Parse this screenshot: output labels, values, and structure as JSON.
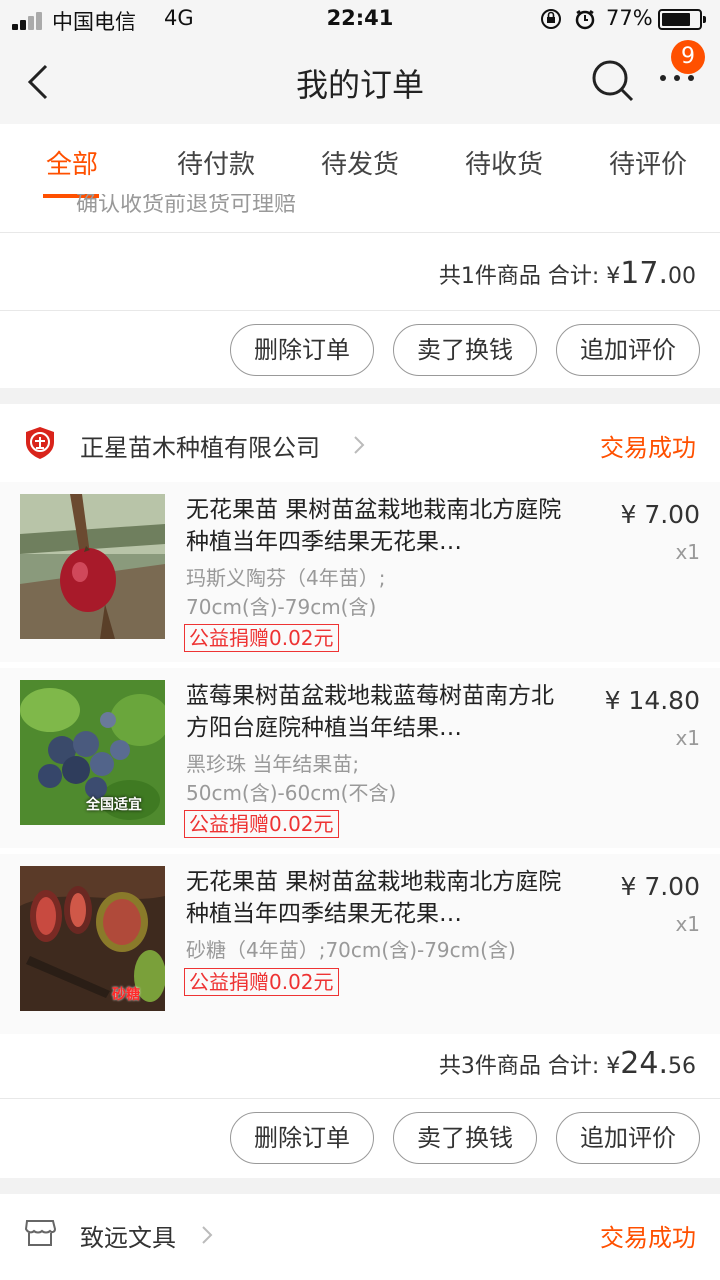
{
  "status_bar": {
    "carrier": "中国电信",
    "network": "4G",
    "time": "22:41",
    "battery": "77%",
    "battery_level": 0.77
  },
  "nav": {
    "title": "我的订单",
    "badge": "9"
  },
  "tabs": [
    {
      "label": "全部",
      "active": true
    },
    {
      "label": "待付款",
      "active": false
    },
    {
      "label": "待发货",
      "active": false
    },
    {
      "label": "待收货",
      "active": false
    },
    {
      "label": "待评价",
      "active": false
    }
  ],
  "order1": {
    "hint": "确认收货前退货可理赔",
    "total_prefix": "共1件商品 合计: ¥",
    "total_int": "17.",
    "total_dec": "00",
    "buttons": [
      "删除订单",
      "卖了换钱",
      "追加评价"
    ]
  },
  "order2": {
    "shop_name": "正星苗木种植有限公司",
    "status": "交易成功",
    "items": [
      {
        "name": "无花果苗 果树苗盆栽地栽南北方庭院种植当年四季结果无花果…",
        "sku_line1": "玛斯义陶芬（4年苗）;",
        "sku_line2": "70cm(含)-79cm(含)",
        "donate": "公益捐赠0.02元",
        "price": "¥ 7.00",
        "qty": "x1"
      },
      {
        "name": "蓝莓果树苗盆栽地栽蓝莓树苗南方北方阳台庭院种植当年结果…",
        "sku_line1": "黑珍珠 当年结果苗;",
        "sku_line2": "50cm(含)-60cm(不含)",
        "donate": "公益捐赠0.02元",
        "price": "¥ 14.80",
        "qty": "x1",
        "thumb_text": "全国适宜"
      },
      {
        "name": "无花果苗 果树苗盆栽地栽南北方庭院种植当年四季结果无花果…",
        "sku_line1": "砂糖（4年苗）;70cm(含)-79cm(含)",
        "sku_line2": "",
        "donate": "公益捐赠0.02元",
        "price": "¥ 7.00",
        "qty": "x1",
        "thumb_text": "砂糖"
      }
    ],
    "total_prefix": "共3件商品 合计: ¥",
    "total_int": "24.",
    "total_dec": "56",
    "buttons": [
      "删除订单",
      "卖了换钱",
      "追加评价"
    ]
  },
  "order3": {
    "shop_name": "致远文具",
    "status": "交易成功"
  }
}
